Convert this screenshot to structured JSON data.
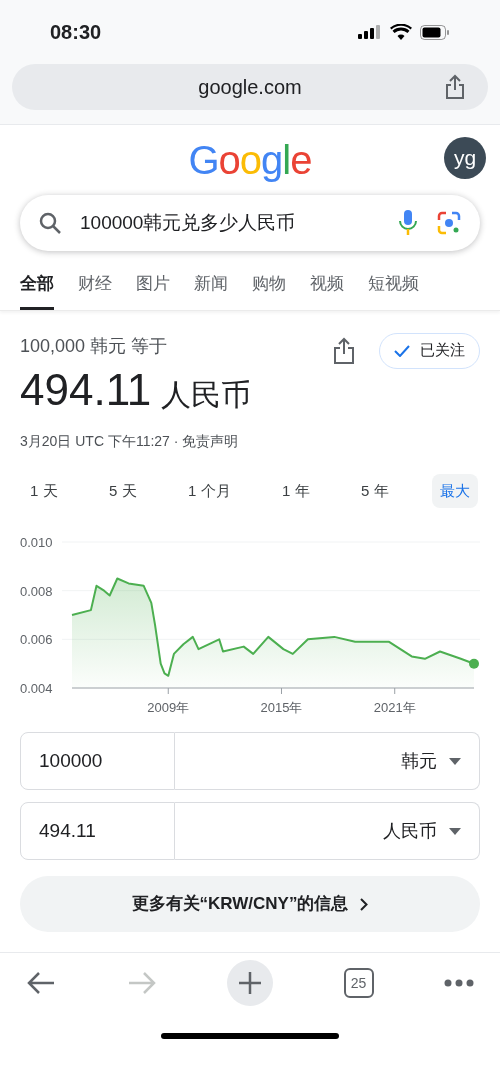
{
  "status_bar": {
    "time": "08:30"
  },
  "address_bar": {
    "url": "google.com"
  },
  "header": {
    "logo": "Google",
    "avatar": "yg"
  },
  "search": {
    "query": "100000韩元兑多少人民币"
  },
  "tabs": [
    {
      "label": "全部",
      "selected": true
    },
    {
      "label": "财经",
      "selected": false
    },
    {
      "label": "图片",
      "selected": false
    },
    {
      "label": "新闻",
      "selected": false
    },
    {
      "label": "购物",
      "selected": false
    },
    {
      "label": "视频",
      "selected": false
    },
    {
      "label": "短视频",
      "selected": false
    }
  ],
  "result": {
    "from": "100,000 韩元 等于",
    "amount": "494.11",
    "unit": "人民币",
    "follow": {
      "label": "已关注",
      "following": true
    },
    "timestamp": "3月20日 UTC 下午11:27 · ",
    "disclaimer": "免责声明"
  },
  "ranges": [
    {
      "label": "1 天",
      "selected": false
    },
    {
      "label": "5 天",
      "selected": false
    },
    {
      "label": "1 个月",
      "selected": false
    },
    {
      "label": "1 年",
      "selected": false
    },
    {
      "label": "5 年",
      "selected": false
    },
    {
      "label": "最大",
      "selected": true
    }
  ],
  "chart_data": {
    "type": "area",
    "xlim": [
      2004,
      2025.3
    ],
    "ylim": [
      0.004,
      0.01
    ],
    "yticks": [
      {
        "value": 0.004,
        "label": "0.004"
      },
      {
        "value": 0.006,
        "label": "0.006"
      },
      {
        "value": 0.008,
        "label": "0.008"
      },
      {
        "value": 0.01,
        "label": "0.010"
      }
    ],
    "xticks": [
      {
        "value": 2009.1,
        "label": "2009年"
      },
      {
        "value": 2015.1,
        "label": "2015年"
      },
      {
        "value": 2021.1,
        "label": "2021年"
      }
    ],
    "x": [
      2004,
      2005,
      2005.3,
      2005.7,
      2006,
      2006.4,
      2007,
      2007.8,
      2008.2,
      2008.4,
      2008.7,
      2008.9,
      2009.1,
      2009.4,
      2009.9,
      2010.4,
      2010.7,
      2011.8,
      2012,
      2013.1,
      2013.6,
      2014.4,
      2015.2,
      2015.7,
      2016.5,
      2017.9,
      2019,
      2020.8,
      2022,
      2022.7,
      2023.5,
      2024.6,
      2025.3
    ],
    "series": [
      {
        "color": "#4caf50",
        "values": [
          0.007,
          0.0072,
          0.0082,
          0.008,
          0.0078,
          0.0085,
          0.0083,
          0.0082,
          0.0075,
          0.0066,
          0.005,
          0.0046,
          0.0045,
          0.0054,
          0.0058,
          0.0061,
          0.0056,
          0.006,
          0.0055,
          0.0057,
          0.0054,
          0.0061,
          0.0056,
          0.0054,
          0.006,
          0.0061,
          0.0059,
          0.0059,
          0.0053,
          0.0052,
          0.0055,
          0.0052,
          0.005
        ]
      }
    ]
  },
  "converter": [
    {
      "value": "100000",
      "currency": "韩元"
    },
    {
      "value": "494.11",
      "currency": "人民币"
    }
  ],
  "more_info": "更多有关“KRW/CNY”的信息",
  "toolbar": {
    "back_enabled": true,
    "forward_enabled": false,
    "tab_count": "25"
  }
}
